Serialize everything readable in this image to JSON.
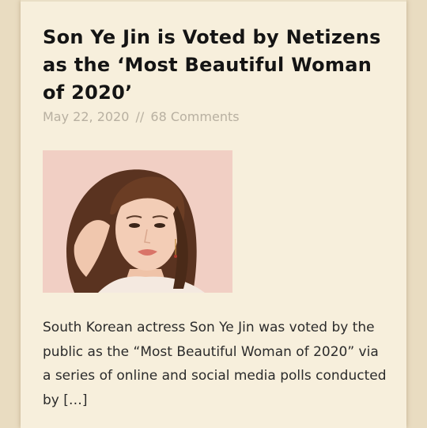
{
  "article": {
    "title": "Son Ye Jin is Voted by Netizens as the ‘Most Beautiful Woman of 2020’",
    "date": "May 22, 2020",
    "separator": "//",
    "comments": "68 Comments",
    "excerpt": "South Korean actress Son Ye Jin was voted by the public as the “Most Beautiful Woman of 2020” via a series of online and social media polls conducted by […]"
  },
  "colors": {
    "page_background": "#e9dcc1",
    "card_background": "#f7efdc",
    "title_text": "#141414",
    "meta_text": "#b8b0a1",
    "body_text": "#2b2b2b",
    "photo_background": "#f1cfc4"
  }
}
